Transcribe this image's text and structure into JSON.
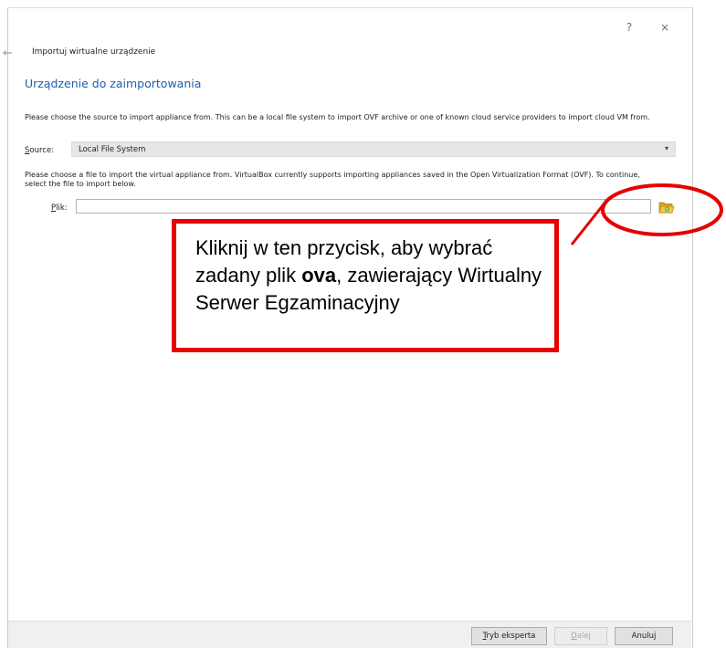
{
  "titlebar": {
    "help_label": "?",
    "close_label": "×"
  },
  "wizard": {
    "title": "Importuj wirtualne urządzenie",
    "page_title": "Urządzenie do zaimportowania",
    "source_description": "Please choose the source to import appliance from. This can be a local file system to import OVF archive or one of known cloud service providers to import cloud VM from.",
    "source_label_first": "S",
    "source_label_rest": "ource:",
    "source_value": "Local File System",
    "file_description": "Please choose a file to import the virtual appliance from. VirtualBox currently supports importing appliances saved in the Open Virtualization Format (OVF). To continue, select the file to import below.",
    "file_label_first": "P",
    "file_label_rest": "lik:",
    "file_value": ""
  },
  "icons": {
    "back": "back-arrow-icon",
    "folder": "folder-open-icon",
    "dropdown": "chevron-down-icon"
  },
  "footer": {
    "expert_first": "T",
    "expert_rest": "ryb eksperta",
    "next_first": "D",
    "next_rest": "alej",
    "cancel": "Anuluj"
  },
  "annotation": {
    "text_before": "Kliknij w ten przycisk, aby wybrać zadany plik ",
    "text_bold": "ova",
    "text_after": ", zawierający Wirtualny Serwer Egzaminacyjny",
    "color": "#e60000"
  }
}
